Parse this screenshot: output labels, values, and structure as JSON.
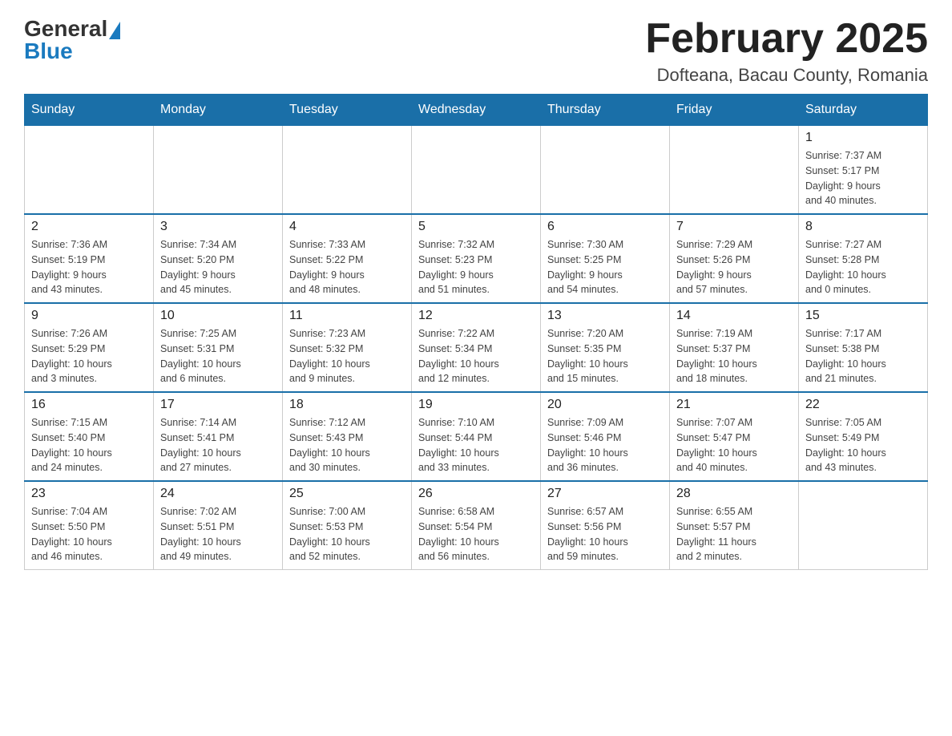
{
  "logo": {
    "general": "General",
    "blue": "Blue"
  },
  "title": "February 2025",
  "location": "Dofteana, Bacau County, Romania",
  "weekdays": [
    "Sunday",
    "Monday",
    "Tuesday",
    "Wednesday",
    "Thursday",
    "Friday",
    "Saturday"
  ],
  "weeks": [
    [
      {
        "day": "",
        "info": ""
      },
      {
        "day": "",
        "info": ""
      },
      {
        "day": "",
        "info": ""
      },
      {
        "day": "",
        "info": ""
      },
      {
        "day": "",
        "info": ""
      },
      {
        "day": "",
        "info": ""
      },
      {
        "day": "1",
        "info": "Sunrise: 7:37 AM\nSunset: 5:17 PM\nDaylight: 9 hours\nand 40 minutes."
      }
    ],
    [
      {
        "day": "2",
        "info": "Sunrise: 7:36 AM\nSunset: 5:19 PM\nDaylight: 9 hours\nand 43 minutes."
      },
      {
        "day": "3",
        "info": "Sunrise: 7:34 AM\nSunset: 5:20 PM\nDaylight: 9 hours\nand 45 minutes."
      },
      {
        "day": "4",
        "info": "Sunrise: 7:33 AM\nSunset: 5:22 PM\nDaylight: 9 hours\nand 48 minutes."
      },
      {
        "day": "5",
        "info": "Sunrise: 7:32 AM\nSunset: 5:23 PM\nDaylight: 9 hours\nand 51 minutes."
      },
      {
        "day": "6",
        "info": "Sunrise: 7:30 AM\nSunset: 5:25 PM\nDaylight: 9 hours\nand 54 minutes."
      },
      {
        "day": "7",
        "info": "Sunrise: 7:29 AM\nSunset: 5:26 PM\nDaylight: 9 hours\nand 57 minutes."
      },
      {
        "day": "8",
        "info": "Sunrise: 7:27 AM\nSunset: 5:28 PM\nDaylight: 10 hours\nand 0 minutes."
      }
    ],
    [
      {
        "day": "9",
        "info": "Sunrise: 7:26 AM\nSunset: 5:29 PM\nDaylight: 10 hours\nand 3 minutes."
      },
      {
        "day": "10",
        "info": "Sunrise: 7:25 AM\nSunset: 5:31 PM\nDaylight: 10 hours\nand 6 minutes."
      },
      {
        "day": "11",
        "info": "Sunrise: 7:23 AM\nSunset: 5:32 PM\nDaylight: 10 hours\nand 9 minutes."
      },
      {
        "day": "12",
        "info": "Sunrise: 7:22 AM\nSunset: 5:34 PM\nDaylight: 10 hours\nand 12 minutes."
      },
      {
        "day": "13",
        "info": "Sunrise: 7:20 AM\nSunset: 5:35 PM\nDaylight: 10 hours\nand 15 minutes."
      },
      {
        "day": "14",
        "info": "Sunrise: 7:19 AM\nSunset: 5:37 PM\nDaylight: 10 hours\nand 18 minutes."
      },
      {
        "day": "15",
        "info": "Sunrise: 7:17 AM\nSunset: 5:38 PM\nDaylight: 10 hours\nand 21 minutes."
      }
    ],
    [
      {
        "day": "16",
        "info": "Sunrise: 7:15 AM\nSunset: 5:40 PM\nDaylight: 10 hours\nand 24 minutes."
      },
      {
        "day": "17",
        "info": "Sunrise: 7:14 AM\nSunset: 5:41 PM\nDaylight: 10 hours\nand 27 minutes."
      },
      {
        "day": "18",
        "info": "Sunrise: 7:12 AM\nSunset: 5:43 PM\nDaylight: 10 hours\nand 30 minutes."
      },
      {
        "day": "19",
        "info": "Sunrise: 7:10 AM\nSunset: 5:44 PM\nDaylight: 10 hours\nand 33 minutes."
      },
      {
        "day": "20",
        "info": "Sunrise: 7:09 AM\nSunset: 5:46 PM\nDaylight: 10 hours\nand 36 minutes."
      },
      {
        "day": "21",
        "info": "Sunrise: 7:07 AM\nSunset: 5:47 PM\nDaylight: 10 hours\nand 40 minutes."
      },
      {
        "day": "22",
        "info": "Sunrise: 7:05 AM\nSunset: 5:49 PM\nDaylight: 10 hours\nand 43 minutes."
      }
    ],
    [
      {
        "day": "23",
        "info": "Sunrise: 7:04 AM\nSunset: 5:50 PM\nDaylight: 10 hours\nand 46 minutes."
      },
      {
        "day": "24",
        "info": "Sunrise: 7:02 AM\nSunset: 5:51 PM\nDaylight: 10 hours\nand 49 minutes."
      },
      {
        "day": "25",
        "info": "Sunrise: 7:00 AM\nSunset: 5:53 PM\nDaylight: 10 hours\nand 52 minutes."
      },
      {
        "day": "26",
        "info": "Sunrise: 6:58 AM\nSunset: 5:54 PM\nDaylight: 10 hours\nand 56 minutes."
      },
      {
        "day": "27",
        "info": "Sunrise: 6:57 AM\nSunset: 5:56 PM\nDaylight: 10 hours\nand 59 minutes."
      },
      {
        "day": "28",
        "info": "Sunrise: 6:55 AM\nSunset: 5:57 PM\nDaylight: 11 hours\nand 2 minutes."
      },
      {
        "day": "",
        "info": ""
      }
    ]
  ]
}
